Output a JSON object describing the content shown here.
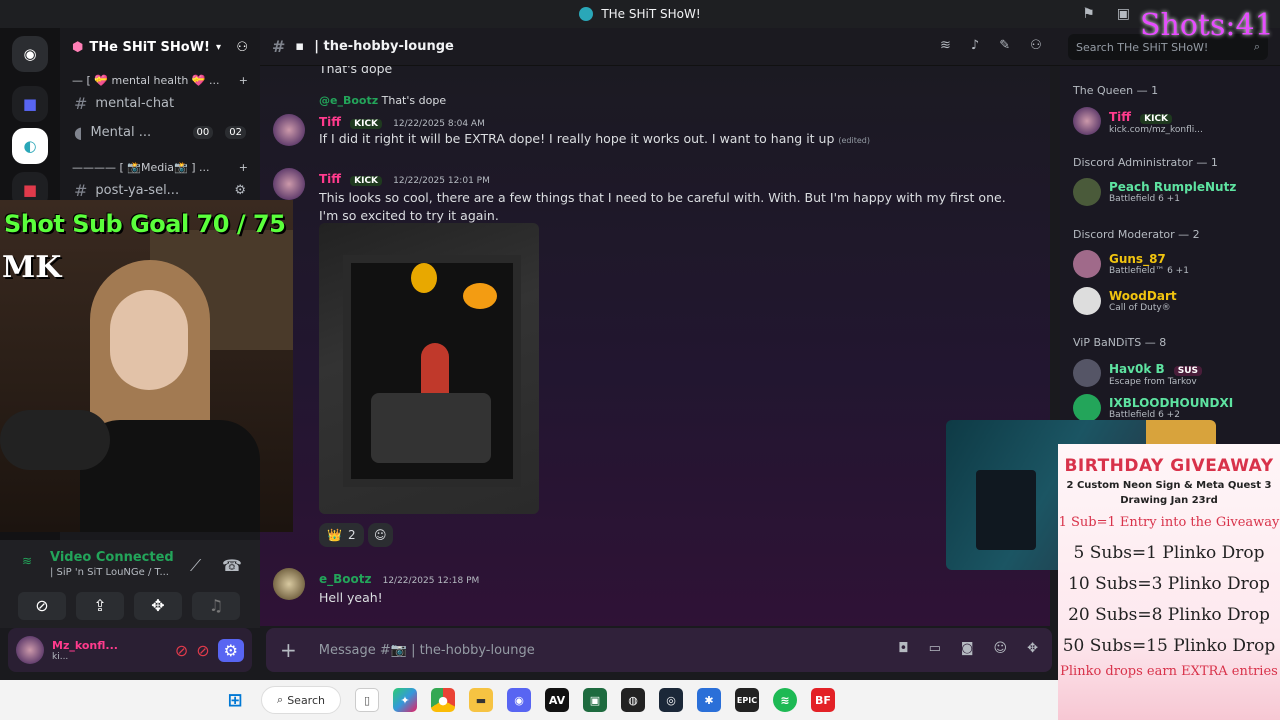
{
  "window": {
    "title": "THe SHiT SHoW!"
  },
  "server": {
    "name": "THe SHiT SHoW!"
  },
  "channels": {
    "cat_mental": "— [ 💝 mental health 💝 ...",
    "mental_chat": "mental-chat",
    "mental_voice": "Mental ...",
    "voice_count_a": "00",
    "voice_count_b": "02",
    "cat_media": "———— [ 📸Media📸 ] ...",
    "post_ya": "post-ya-sel..."
  },
  "header": {
    "channel": "| the-hobby-lounge",
    "search_placeholder": "Search THe SHiT SHoW!"
  },
  "messages": [
    {
      "text_prev": "That's dope"
    },
    {
      "reply_user": "@e_Bootz",
      "reply_text": "That's dope",
      "user": "Tiff",
      "badge": "KICK",
      "time": "12/22/2025 8:04 AM",
      "text": "If I did it right it will be EXTRA dope! I really hope it works out. I want to hang it up",
      "edited": "(edited)"
    },
    {
      "user": "Tiff",
      "badge": "KICK",
      "time": "12/22/2025 12:01 PM",
      "text": "This looks so cool, there are a few things that I need to be careful with. With. But I'm happy with my first one. I'm so excited to try it again."
    },
    {
      "user": "e_Bootz",
      "time": "12/22/2025 12:18 PM",
      "text": "Hell yeah!"
    }
  ],
  "reaction": {
    "emoji": "👑",
    "count": "2"
  },
  "composer": {
    "placeholder": "Message #📷 | the-hobby-lounge"
  },
  "members": {
    "role_queen": "The Queen — 1",
    "queen_name": "Tiff",
    "queen_badge": "KICK",
    "queen_status": "kick.com/mz_konfli...",
    "role_admin": "Discord Administrator — 1",
    "admin_name": "Peach RumpleNutz",
    "admin_status": "Battlefield 6 +1",
    "role_mod": "Discord Moderator — 2",
    "mod1_name": "Guns_87",
    "mod1_status": "Battlefield™ 6 +1",
    "mod2_name": "WoodDart",
    "mod2_status": "Call of Duty®",
    "role_vip": "ViP BaNDiTS — 8",
    "vip1_name": "Hav0k B",
    "vip1_badge": "SUS",
    "vip1_status": "Escape from Tarkov",
    "vip2_name": "IXBLOODHOUNDXI",
    "vip2_status": "Battlefield 6 +2"
  },
  "voice": {
    "status": "Video Connected",
    "channel": "| SiP 'n SiT LouNGe / T..."
  },
  "user": {
    "name": "Mz_konfl...",
    "status": "ki..."
  },
  "overlay": {
    "goal": "Shot Sub Goal 70 / 75",
    "mk": "MK",
    "shots": "Shots:41"
  },
  "giveaway": {
    "title": "BIRTHDAY GIVEAWAY",
    "sub1": "2 Custom Neon Sign & Meta Quest 3",
    "sub2": "Drawing Jan 23rd",
    "l1": "1 Sub=1 Entry into the Giveaway",
    "l2": "5 Subs=1 Plinko Drop",
    "l3": "10 Subs=3 Plinko Drop",
    "l4": "20 Subs=8 Plinko Drop",
    "l5": "50 Subs=15 Plinko Drop",
    "l6": "Plinko drops earn EXTRA entries"
  },
  "taskbar": {
    "search": "Search"
  },
  "colors": {
    "accent": "#5865f2",
    "green": "#23a55a",
    "pink": "#e64cff",
    "kick": "#53fc18"
  }
}
